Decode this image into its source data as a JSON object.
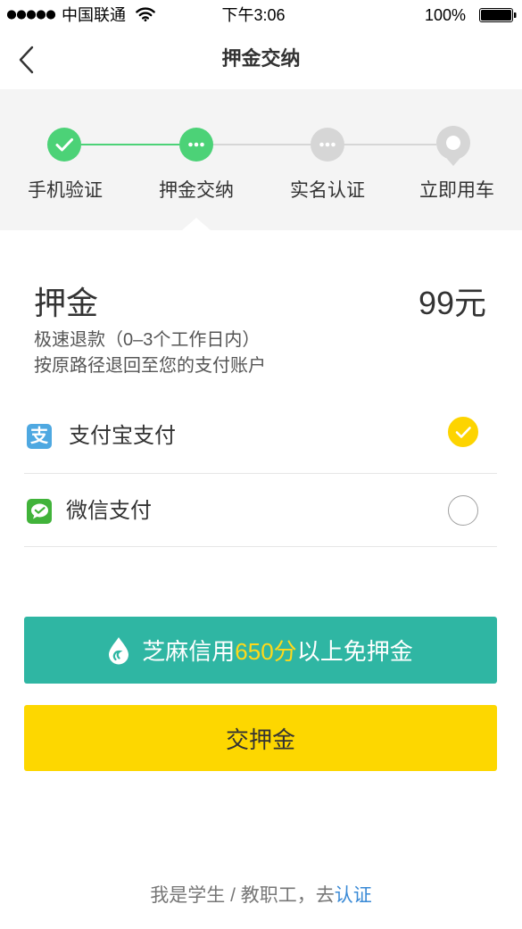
{
  "status_bar": {
    "signal_strength": 5,
    "carrier": "中国联通",
    "time": "下午3:06",
    "battery": "100%",
    "icons": [
      "signal-dots-icon",
      "wifi-icon",
      "battery-icon"
    ]
  },
  "nav": {
    "title": "押金交纳",
    "back_icon": "chevron-left-icon"
  },
  "steps": [
    {
      "label": "手机验证",
      "state": "done",
      "icon": "check-icon"
    },
    {
      "label": "押金交纳",
      "state": "current",
      "icon": "ellipsis-icon"
    },
    {
      "label": "实名认证",
      "state": "pending",
      "icon": "ellipsis-icon"
    },
    {
      "label": "立即用车",
      "state": "pending",
      "icon": "location-pin-icon"
    }
  ],
  "deposit": {
    "title": "押金",
    "amount": "99元",
    "notes": [
      "极速退款（0–3个工作日内）",
      "按原路径退回至您的支付账户"
    ]
  },
  "payment_methods": [
    {
      "label": "支付宝支付",
      "icon": "alipay-icon",
      "logo_glyph": "支",
      "selected": true
    },
    {
      "label": "微信支付",
      "icon": "wechat-pay-icon",
      "selected": false
    }
  ],
  "zhima_button": {
    "icon": "sesame-credit-drop-icon",
    "text_before": "芝麻信用",
    "score": "650分",
    "text_after": "以上免押金"
  },
  "pay_button": {
    "label": "交押金"
  },
  "footer": {
    "text": "我是学生 / 教职工，去",
    "link": "认证"
  },
  "colors": {
    "step_done": "#4cd277",
    "step_pending": "#d6d6d6",
    "step_background": "#f4f4f4",
    "zhima_button": "#2fb6a3",
    "score_highlight": "#ffd91a",
    "pay_button": "#fdd700",
    "selected_check": "#fdd400",
    "link": "#3a8ad6",
    "alipay": "#4ea8e1",
    "wechat": "#41b33a"
  }
}
